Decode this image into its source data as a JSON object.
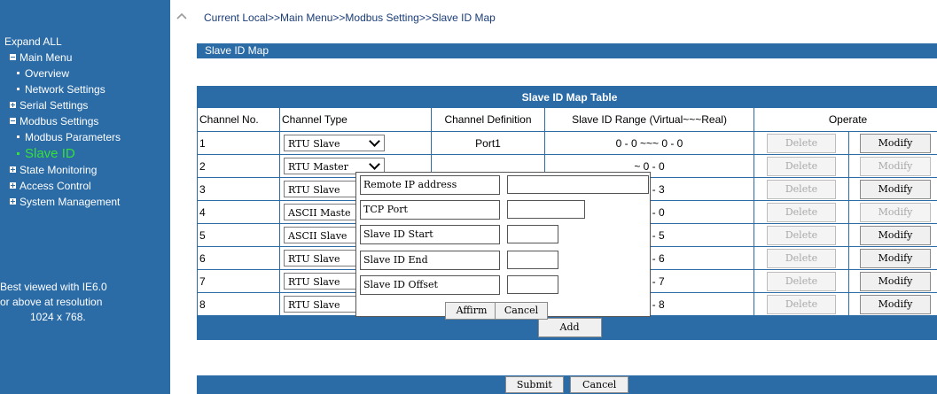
{
  "sidebar": {
    "expand_all": "Expand ALL",
    "items": [
      {
        "label": "Main Menu",
        "level": 1,
        "icon": "minus-box-icon"
      },
      {
        "label": "Overview",
        "level": 2,
        "icon": "bullet-icon"
      },
      {
        "label": "Network Settings",
        "level": 2,
        "icon": "bullet-icon"
      },
      {
        "label": "Serial Settings",
        "level": 1,
        "icon": "plus-box-icon"
      },
      {
        "label": "Modbus Settings",
        "level": 1,
        "icon": "minus-box-icon"
      },
      {
        "label": "Modbus Parameters",
        "level": 2,
        "icon": "bullet-icon"
      },
      {
        "label": "Slave ID",
        "level": 2,
        "icon": "bullet-icon",
        "active": true
      },
      {
        "label": "State Monitoring",
        "level": 1,
        "icon": "plus-box-icon"
      },
      {
        "label": "Access Control",
        "level": 1,
        "icon": "plus-box-icon"
      },
      {
        "label": "System Management",
        "level": 1,
        "icon": "plus-box-icon"
      }
    ],
    "note_lines": [
      "Best viewed with IE6.0",
      "or above at resolution",
      "1024 x 768."
    ]
  },
  "breadcrumb": "Current Local>>Main Menu>>Modbus Setting>>Slave ID Map",
  "section_title": "Slave ID Map",
  "table": {
    "title": "Slave ID Map Table",
    "headers": [
      "Channel No.",
      "Channel Type",
      "Channel Definition",
      "Slave ID Range (Virtual~~~Real)",
      "Operate"
    ],
    "rows": [
      {
        "no": "1",
        "type": "RTU Slave",
        "def": "Port1",
        "range": "0 - 0 ~~~ 0 - 0",
        "delete": "Delete",
        "modify": "Modify",
        "modify_enabled": true
      },
      {
        "no": "2",
        "type": "RTU Master",
        "def": "",
        "range": "~ 0 - 0",
        "delete": "Delete",
        "modify": "Modify",
        "modify_enabled": false
      },
      {
        "no": "3",
        "type": "RTU Slave",
        "def": "",
        "range": "~ 3 - 3",
        "delete": "Delete",
        "modify": "Modify",
        "modify_enabled": true
      },
      {
        "no": "4",
        "type": "ASCII Maste",
        "def": "",
        "range": "~ 0 - 0",
        "delete": "Delete",
        "modify": "Modify",
        "modify_enabled": false
      },
      {
        "no": "5",
        "type": "ASCII Slave",
        "def": "",
        "range": "~ 5 - 5",
        "delete": "Delete",
        "modify": "Modify",
        "modify_enabled": true
      },
      {
        "no": "6",
        "type": "RTU Slave",
        "def": "",
        "range": "~ 6 - 6",
        "delete": "Delete",
        "modify": "Modify",
        "modify_enabled": true
      },
      {
        "no": "7",
        "type": "RTU Slave",
        "def": "",
        "range": "~ 7 - 7",
        "delete": "Delete",
        "modify": "Modify",
        "modify_enabled": true
      },
      {
        "no": "8",
        "type": "RTU Slave",
        "def": "",
        "range": "~ 8 - 8",
        "delete": "Delete",
        "modify": "Modify",
        "modify_enabled": true
      }
    ],
    "add_label": "Add"
  },
  "footer": {
    "submit_label": "Submit",
    "cancel_label": "Cancel"
  },
  "popup": {
    "fields": [
      {
        "label": "Remote IP address",
        "value": ""
      },
      {
        "label": "TCP Port",
        "value": ""
      },
      {
        "label": "Slave ID Start",
        "value": ""
      },
      {
        "label": "Slave ID End",
        "value": ""
      },
      {
        "label": "Slave ID Offset",
        "value": ""
      }
    ],
    "affirm_label": "Affirm",
    "cancel_label": "Cancel"
  },
  "colors": {
    "accent": "#2b6ba6",
    "active_menu": "#35e03a",
    "breadcrumb": "#1a3d77"
  }
}
